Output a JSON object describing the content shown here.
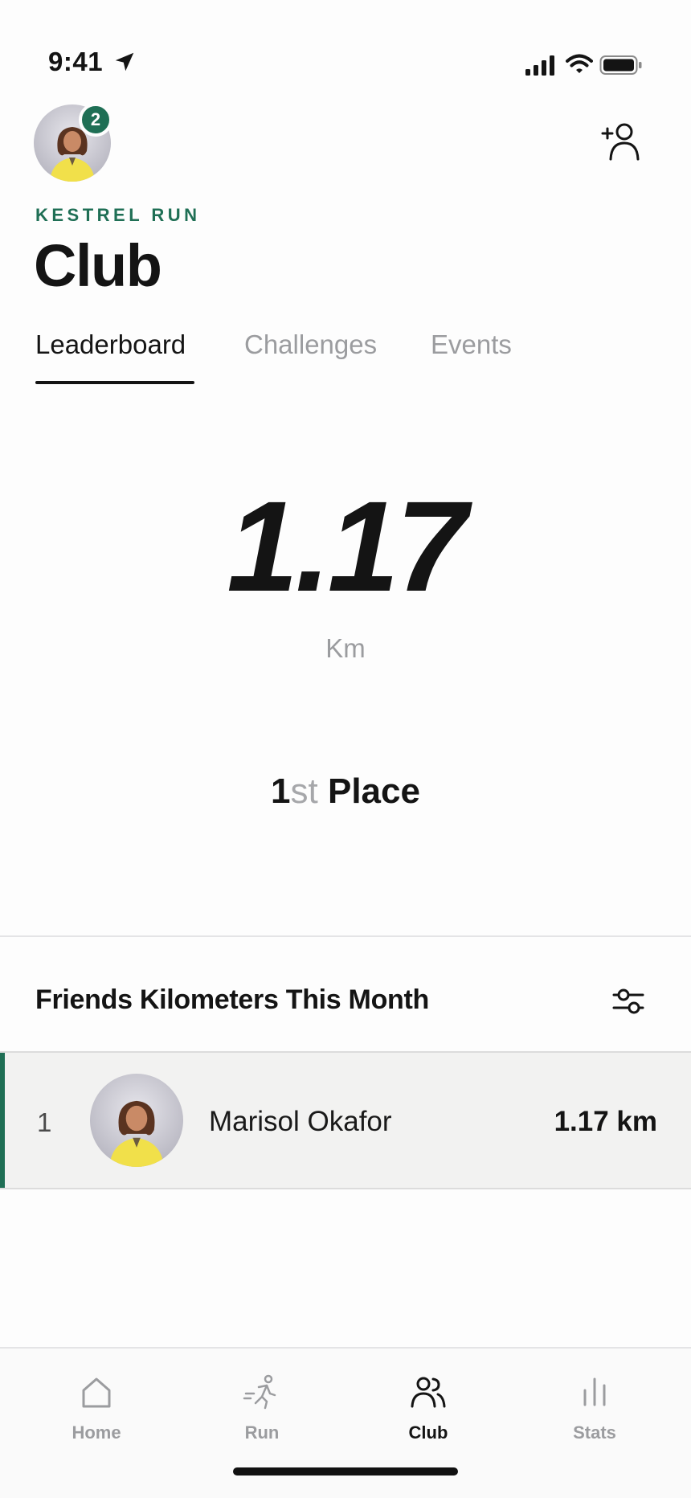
{
  "status_bar": {
    "time": "9:41",
    "icons": [
      "location-arrow-icon",
      "cellular-signal-icon",
      "wifi-icon",
      "battery-icon"
    ]
  },
  "header": {
    "notification_count": "2",
    "brand": "KESTREL RUN",
    "title": "Club",
    "add_friend_icon": "add-person-icon"
  },
  "tabs": [
    {
      "label": "Leaderboard",
      "active": true
    },
    {
      "label": "Challenges",
      "active": false
    },
    {
      "label": "Events",
      "active": false
    }
  ],
  "summary": {
    "distance": "1.17",
    "unit": "Km",
    "place_number": "1",
    "place_suffix": "st",
    "place_word": "Place"
  },
  "leaderboard": {
    "title": "Friends Kilometers This Month",
    "filter_icon": "sliders-icon",
    "rows": [
      {
        "rank": "1",
        "name": "Marisol Okafor",
        "distance": "1.17 km"
      }
    ]
  },
  "nav": {
    "items": [
      {
        "label": "Home",
        "icon": "home-icon",
        "active": false
      },
      {
        "label": "Run",
        "icon": "runner-icon",
        "active": false
      },
      {
        "label": "Club",
        "icon": "club-people-icon",
        "active": true
      },
      {
        "label": "Stats",
        "icon": "stats-bars-icon",
        "active": false
      }
    ]
  },
  "colors": {
    "brand_green": "#1f6f55",
    "text_primary": "#141414",
    "text_muted": "#9b9c9f",
    "highlight_row": "#f2f2f1"
  }
}
